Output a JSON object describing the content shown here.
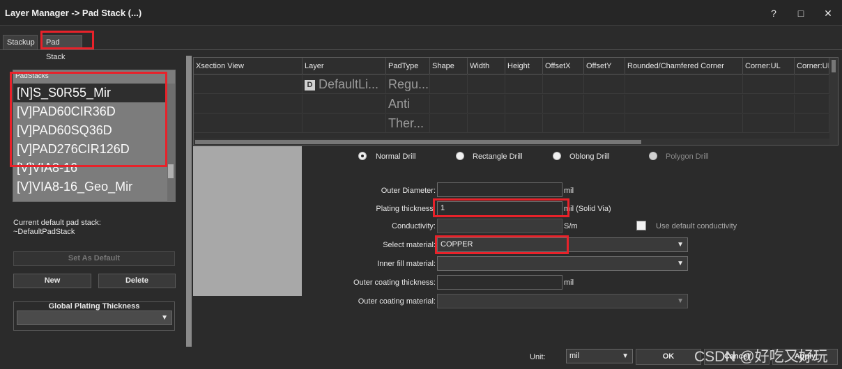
{
  "window": {
    "title": "Layer Manager -> Pad Stack (...)",
    "help_icon": "?",
    "maximize_icon": "□",
    "close_icon": "✕"
  },
  "tabs": [
    {
      "label": "Stackup",
      "active": false
    },
    {
      "label": "Pad Stack",
      "active": true
    }
  ],
  "padstacks": {
    "caption": "PadStacks",
    "items": [
      "[N]S_S0R55_Mir",
      "[V]PAD60CIR36D",
      "[V]PAD60SQ36D",
      "[V]PAD276CIR126D",
      "[V]VIA8-16",
      "[V]VIA8-16_Geo_Mir"
    ],
    "selected_index": 0,
    "current_default_label": "Current default pad stack:",
    "current_default_value": "~DefaultPadStack",
    "set_default_label": "Set As Default",
    "new_label": "New",
    "delete_label": "Delete",
    "global_plating_label": "Global Plating Thickness",
    "global_plating_value": ""
  },
  "grid": {
    "columns": [
      "Xsection View",
      "Layer",
      "PadType",
      "Shape",
      "Width",
      "Height",
      "OffsetX",
      "OffsetY",
      "Rounded/Chamfered Corner",
      "Corner:UL",
      "Corner:UI"
    ],
    "rows": [
      {
        "layer_icon": "D",
        "layer": "DefaultLi...",
        "padtype": "Regu..."
      },
      {
        "layer_icon": "",
        "layer": "",
        "padtype": "Anti"
      },
      {
        "layer_icon": "",
        "layer": "",
        "padtype": "Ther..."
      }
    ]
  },
  "drill": {
    "options": [
      {
        "label": "Normal Drill",
        "checked": true,
        "enabled": true
      },
      {
        "label": "Rectangle Drill",
        "checked": false,
        "enabled": true
      },
      {
        "label": "Oblong Drill",
        "checked": false,
        "enabled": true
      },
      {
        "label": "Polygon Drill",
        "checked": false,
        "enabled": false
      }
    ]
  },
  "form": {
    "outer_diameter": {
      "label": "Outer Diameter:",
      "value": "",
      "unit": "mil"
    },
    "plating_thickness": {
      "label": "Plating thickness:",
      "value": "1",
      "unit": "mil (Solid Via)"
    },
    "conductivity": {
      "label": "Conductivity:",
      "value": "",
      "unit": "S/m"
    },
    "use_default_conductivity": {
      "label": "Use default conductivity",
      "checked": false
    },
    "select_material": {
      "label": "Select material:",
      "value": "COPPER"
    },
    "inner_fill_material": {
      "label": "Inner fill material:",
      "value": ""
    },
    "outer_coating_thickness": {
      "label": "Outer coating thickness:",
      "value": "",
      "unit": "mil"
    },
    "outer_coating_material": {
      "label": "Outer coating material:",
      "value": ""
    }
  },
  "footer": {
    "unit_label": "Unit:",
    "unit_value": "mil",
    "ok_label": "OK",
    "cancel_label": "Cancel",
    "apply_label": "Apply",
    "watermark": "CSDN @好吃又好玩"
  },
  "colors": {
    "highlight_box": "#e8222a",
    "background": "#2b2b2b",
    "list_background": "#7c7c7c"
  }
}
